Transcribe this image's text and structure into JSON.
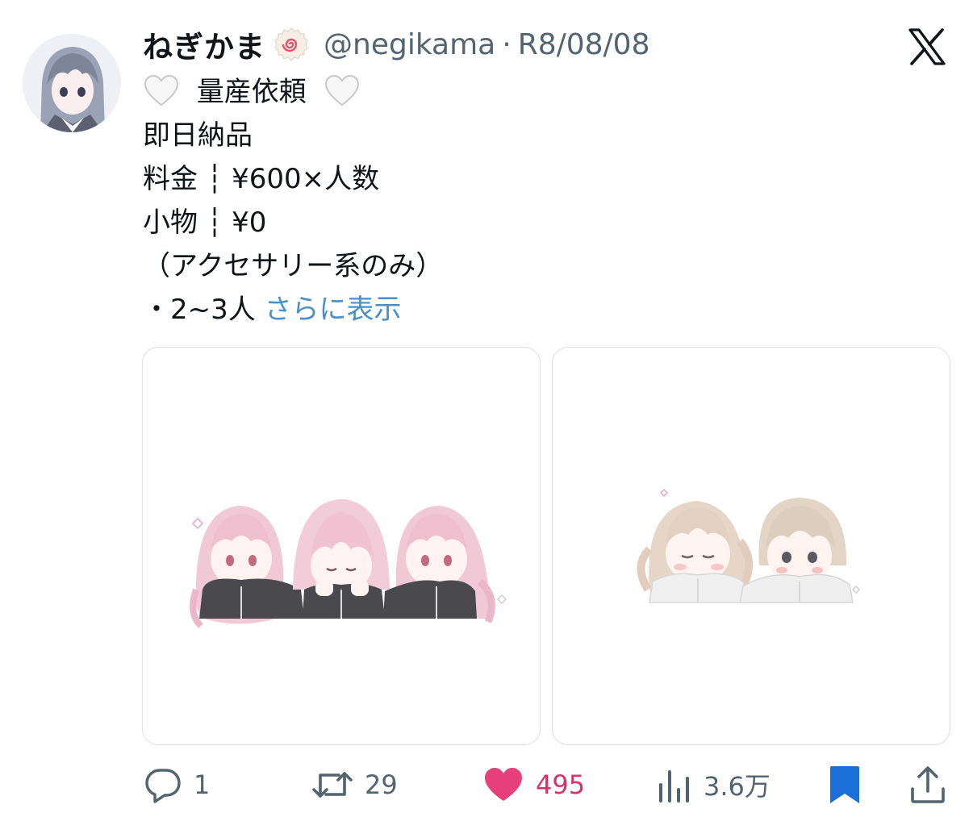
{
  "author": {
    "display_name": "ねぎかま",
    "badge_icon": "naruto-fishcake-emoji",
    "handle": "@negikama",
    "separator": "·",
    "date": "R8/08/08"
  },
  "platform_icon": "x-logo-icon",
  "body": {
    "line1_text": "量産依頼",
    "line1_icons": [
      "white-heart-emoji",
      "white-heart-emoji"
    ],
    "line2": "即日納品",
    "line3": "料金 ┆ ¥600×人数",
    "line4": "小物 ┆ ¥0",
    "line5": "（アクセサリー系のみ）",
    "line6_prefix": "・2~3人 ",
    "show_more": "さらに表示"
  },
  "media": [
    {
      "description_icon": "three-chibi-girls-image"
    },
    {
      "description_icon": "two-chibi-characters-image"
    }
  ],
  "actions": {
    "reply_count": "1",
    "retweet_count": "29",
    "like_count": "495",
    "views_count": "3.6万"
  },
  "colors": {
    "like": "#d6336c",
    "link": "#4a90c8",
    "muted": "#536471",
    "bookmark": "#1d6fd8"
  }
}
